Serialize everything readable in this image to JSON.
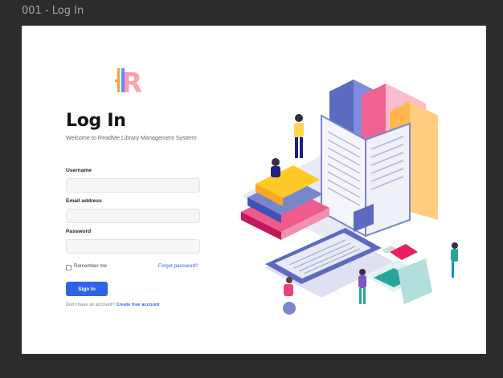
{
  "frame": {
    "label": "001 - Log In"
  },
  "login": {
    "title": "Log In",
    "subtitle": "Welcome to ReadMe Library Management System!",
    "username_label": "Username",
    "username_value": "",
    "email_label": "Email address",
    "email_value": "",
    "password_label": "Password",
    "password_value": "",
    "remember_label": "Remember me",
    "remember_checked": false,
    "forgot_label": "Forgot password?",
    "signin_label": "Sign In",
    "signup_prompt": "Don't have an account?",
    "signup_link": "Create free account"
  },
  "logo": {
    "letter": "R",
    "icon": "readme-logo-icon"
  },
  "illustration": {
    "icon": "library-isometric-illustration"
  },
  "colors": {
    "accent": "#2d63e6",
    "background": "#2c2c2c",
    "card": "#ffffff"
  }
}
